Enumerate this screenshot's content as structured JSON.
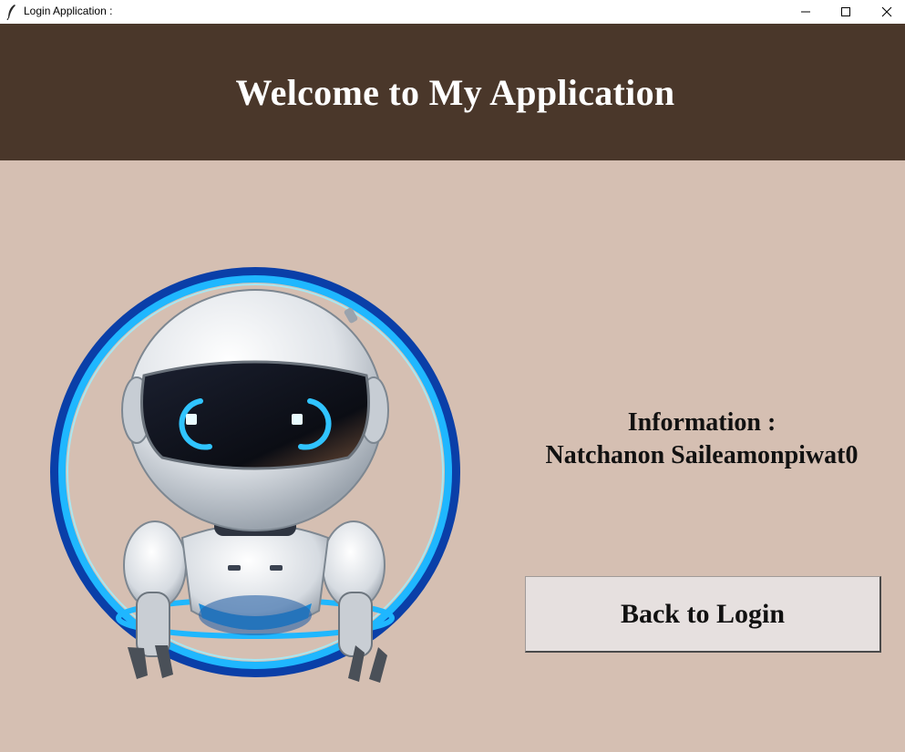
{
  "window": {
    "title": "Login Application :",
    "controls": {
      "minimize_icon": "minimize-icon",
      "maximize_icon": "maximize-icon",
      "close_icon": "close-icon"
    }
  },
  "header": {
    "title": "Welcome to My Application",
    "background": "#4a372a"
  },
  "main": {
    "background": "#d5bfb2",
    "image": "robot-illustration",
    "info_label": "Information :",
    "info_value": "Natchanon Saileamonpiwat0",
    "back_button_label": "Back to Login"
  }
}
